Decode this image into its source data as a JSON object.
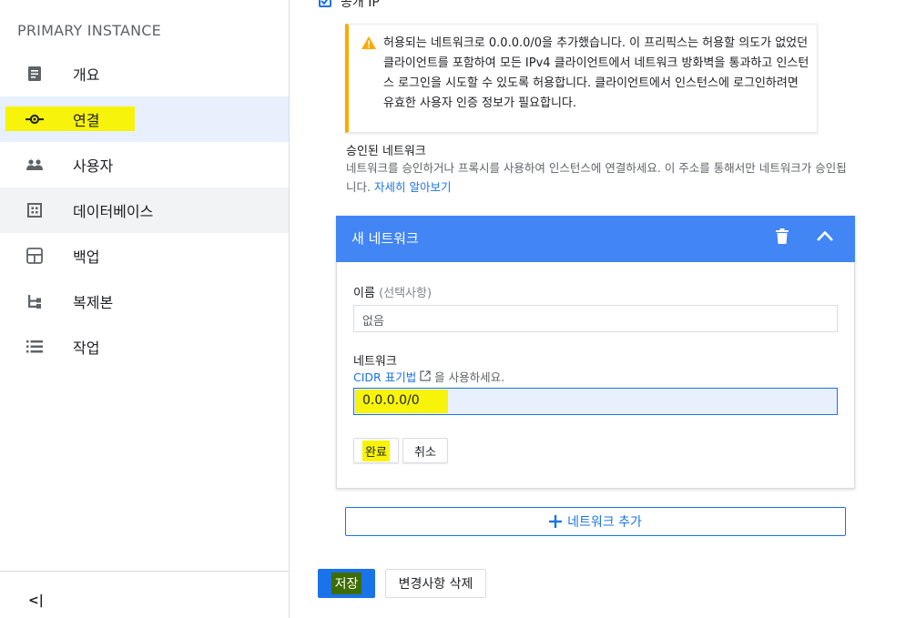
{
  "sidebar": {
    "title": "PRIMARY INSTANCE",
    "items": [
      {
        "label": "개요",
        "icon": "overview-icon"
      },
      {
        "label": "연결",
        "icon": "connection-icon"
      },
      {
        "label": "사용자",
        "icon": "users-icon"
      },
      {
        "label": "데이터베이스",
        "icon": "database-icon"
      },
      {
        "label": "백업",
        "icon": "backup-icon"
      },
      {
        "label": "복제본",
        "icon": "replica-icon"
      },
      {
        "label": "작업",
        "icon": "operations-icon"
      }
    ],
    "collapse_label": "<|"
  },
  "main": {
    "checkbox_label": "공개 IP",
    "warning_text": "허용되는 네트워크로 0.0.0.0/0을 추가했습니다. 이 프리픽스는 허용할 의도가 없었던 클라이언트를 포함하여 모든 IPv4 클라이언트에서 네트워크 방화벽을 통과하고 인스턴스 로그인을 시도할 수 있도록 허용합니다. 클라이언트에서 인스턴스에 로그인하려면 유효한 사용자 인증 정보가 필요합니다.",
    "authorized": {
      "title": "승인된 네트워크",
      "desc": "네트워크를 승인하거나 프록시를 사용하여 인스턴스에 연결하세요. 이 주소를 통해서만 네트워크가 승인됩니다.",
      "learn_more": "자세히 알아보기"
    },
    "panel": {
      "title": "새 네트워크",
      "name_label": "이름",
      "name_optional": "(선택사항)",
      "name_value": "없음",
      "network_label": "네트워크",
      "cidr_link": "CIDR 표기법",
      "cidr_suffix": "을 사용하세요.",
      "network_value": "0.0.0.0/0",
      "done_label": "완료",
      "cancel_label": "취소"
    },
    "add_network_label": "네트워크 추가",
    "save_label": "저장",
    "discard_label": "변경사항 삭제"
  },
  "colors": {
    "primary": "#1a73e8",
    "header_blue": "#4285f4",
    "warning": "#f9ab00",
    "highlight": "#f7f30a"
  }
}
